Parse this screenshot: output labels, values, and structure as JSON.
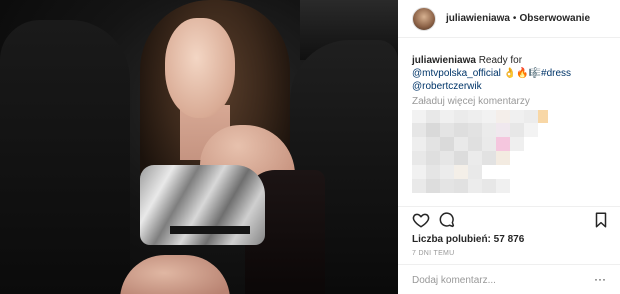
{
  "header": {
    "username": "juliawieniawa",
    "separator": "•",
    "follow_label": "Obserwowanie"
  },
  "caption": {
    "username": "juliawieniawa",
    "text_start": "Ready for",
    "mention": "@mtvpolska_official",
    "emoji": "👌🔥🎼",
    "hashtag": "#dress",
    "mention2": "@robertczerwik"
  },
  "comments": {
    "load_more_label": "Załaduj więcej komentarzy"
  },
  "actions": {
    "like_icon": "heart-icon",
    "comment_icon": "comment-icon",
    "save_icon": "bookmark-icon"
  },
  "likes": {
    "label": "Liczba polubień:",
    "count": "57 876"
  },
  "timestamp": "7 DNI TEMU",
  "comment_box": {
    "placeholder": "Dodaj komentarz...",
    "more_symbol": "···"
  }
}
